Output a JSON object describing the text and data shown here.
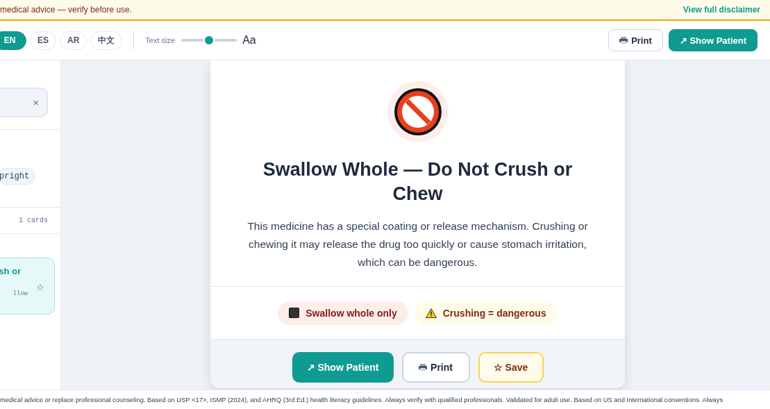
{
  "banner": {
    "text": "medical advice — verify before use.",
    "link": "View full disclaimer"
  },
  "toolbar": {
    "languages": [
      {
        "label": "EN",
        "selected": true
      },
      {
        "label": "ES",
        "selected": false
      },
      {
        "label": "AR",
        "selected": false
      },
      {
        "label": "中文",
        "selected": false
      }
    ],
    "text_size": {
      "label": "Text size",
      "level": 0.5,
      "sample": "Aa"
    },
    "buttons": [
      {
        "label": "Print",
        "kind": "print"
      },
      {
        "label": "↗ Show Patient",
        "kind": "primary"
      }
    ]
  },
  "sidebar": {
    "search": {
      "clear": "×"
    },
    "chips": [
      "pright"
    ],
    "count": "1 cards",
    "cards": [
      {
        "title": "sh or",
        "subtitle": "llow",
        "star": "☆",
        "selected": true
      }
    ]
  },
  "card": {
    "title": "Swallow Whole — Do Not Crush or Chew",
    "description": "This medicine has a special coating or release mechanism. Crushing or chewing it may release the drug too quickly or cause stomach irritation, which can be dangerous.",
    "tags": [
      {
        "label": "Swallow whole only",
        "kind": "stop"
      },
      {
        "label": "Crushing = dangerous",
        "kind": "warning"
      }
    ],
    "actions": [
      {
        "label": "↗ Show Patient",
        "kind": "primary"
      },
      {
        "label": "Print",
        "kind": "print"
      },
      {
        "label": "☆ Save",
        "kind": "save"
      }
    ]
  },
  "footer": {
    "text": "medical advice or replace professional counseling. Based on USP <17>, ISMP (2024), and AHRQ (3rd Ed.) health literacy guidelines. Always verify with qualified professionals. Validated for adult use. Based on US and International conventions. Always"
  }
}
